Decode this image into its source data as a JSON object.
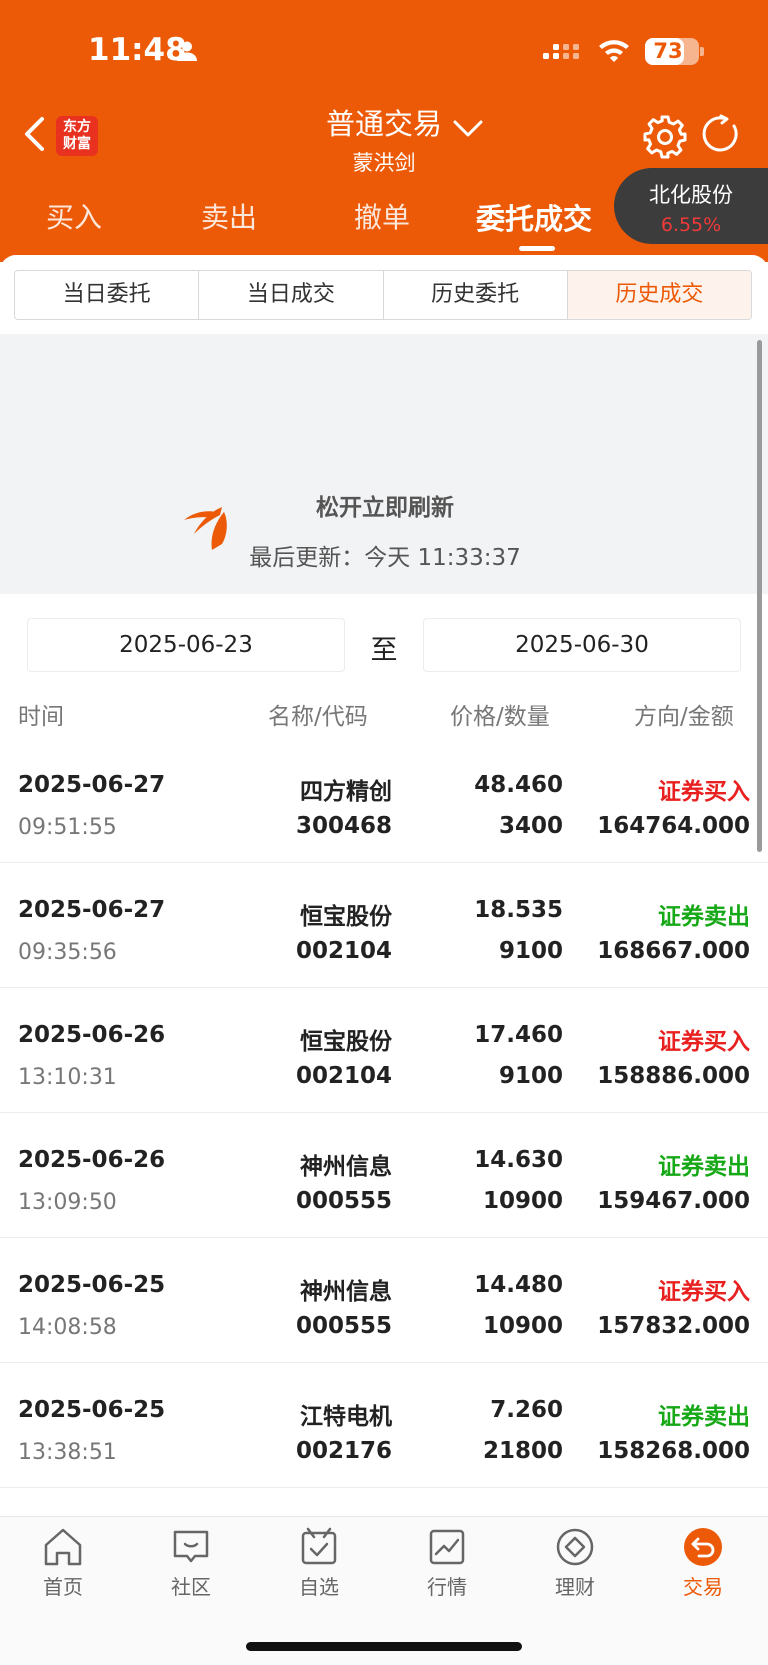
{
  "status": {
    "time": "11:48",
    "battery": "73",
    "battery_level": 0.73
  },
  "header": {
    "logo_text": [
      "东方",
      "财富"
    ],
    "title": "普通交易",
    "subtitle": "蒙洪剑"
  },
  "tabs": [
    {
      "label": "买入",
      "active": false
    },
    {
      "label": "卖出",
      "active": false
    },
    {
      "label": "撤单",
      "active": false
    },
    {
      "label": "委托成交",
      "active": true
    }
  ],
  "stock_badge": {
    "name": "北化股份",
    "pct": "6.55%"
  },
  "segments": [
    {
      "label": "当日委托",
      "active": false
    },
    {
      "label": "当日成交",
      "active": false
    },
    {
      "label": "历史委托",
      "active": false
    },
    {
      "label": "历史成交",
      "active": true
    }
  ],
  "pull_refresh": {
    "title": "松开立即刷新",
    "last_update": "最后更新：今天 11:33:37"
  },
  "date_range": {
    "start": "2025-06-23",
    "separator": "至",
    "end": "2025-06-30"
  },
  "columns": [
    "时间",
    "名称/代码",
    "价格/数量",
    "方向/金额"
  ],
  "rows": [
    {
      "date": "2025-06-27",
      "time": "09:51:55",
      "name": "四方精创",
      "code": "300468",
      "price": "48.460",
      "qty": "3400",
      "direction": "证券买入",
      "amount": "164764.000",
      "side": "buy"
    },
    {
      "date": "2025-06-27",
      "time": "09:35:56",
      "name": "恒宝股份",
      "code": "002104",
      "price": "18.535",
      "qty": "9100",
      "direction": "证券卖出",
      "amount": "168667.000",
      "side": "sell"
    },
    {
      "date": "2025-06-26",
      "time": "13:10:31",
      "name": "恒宝股份",
      "code": "002104",
      "price": "17.460",
      "qty": "9100",
      "direction": "证券买入",
      "amount": "158886.000",
      "side": "buy"
    },
    {
      "date": "2025-06-26",
      "time": "13:09:50",
      "name": "神州信息",
      "code": "000555",
      "price": "14.630",
      "qty": "10900",
      "direction": "证券卖出",
      "amount": "159467.000",
      "side": "sell"
    },
    {
      "date": "2025-06-25",
      "time": "14:08:58",
      "name": "神州信息",
      "code": "000555",
      "price": "14.480",
      "qty": "10900",
      "direction": "证券买入",
      "amount": "157832.000",
      "side": "buy"
    },
    {
      "date": "2025-06-25",
      "time": "13:38:51",
      "name": "江特电机",
      "code": "002176",
      "price": "7.260",
      "qty": "21800",
      "direction": "证券卖出",
      "amount": "158268.000",
      "side": "sell"
    }
  ],
  "nav": [
    {
      "label": "首页",
      "icon": "home-icon",
      "active": false
    },
    {
      "label": "社区",
      "icon": "chat-icon",
      "active": false
    },
    {
      "label": "自选",
      "icon": "checkbox-icon",
      "active": false
    },
    {
      "label": "行情",
      "icon": "chart-icon",
      "active": false
    },
    {
      "label": "理财",
      "icon": "diamond-icon",
      "active": false
    },
    {
      "label": "交易",
      "icon": "trade-icon",
      "active": true
    }
  ],
  "colors": {
    "brand": "#EC5A07",
    "buy": "#E82020",
    "sell": "#16A816"
  }
}
